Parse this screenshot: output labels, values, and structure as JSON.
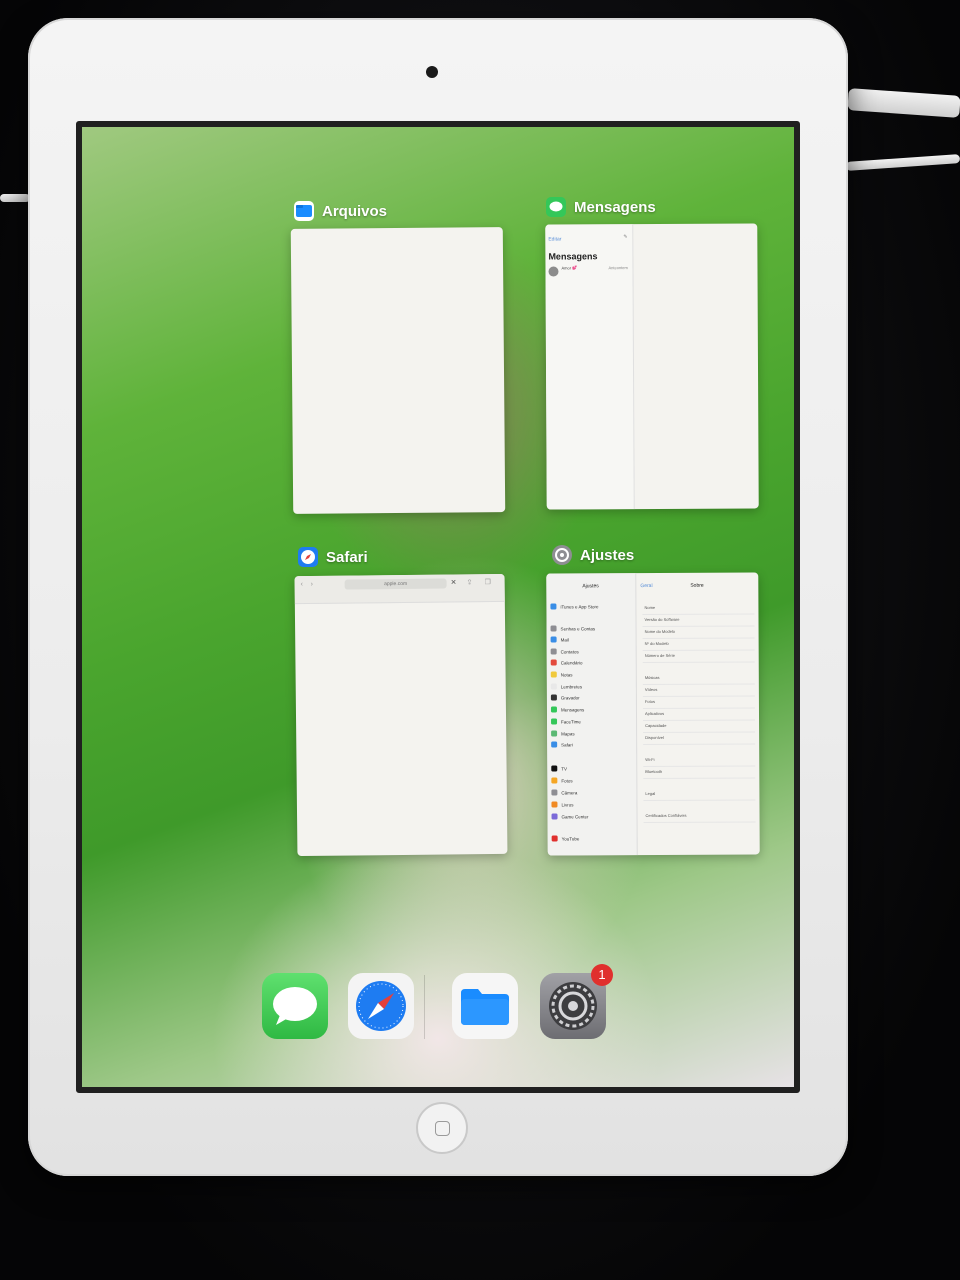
{
  "app_switcher": {
    "cards": [
      {
        "label": "Arquivos",
        "icon": "files-icon"
      },
      {
        "label": "Mensagens",
        "icon": "messages-icon",
        "preview": {
          "nav_back": "Editar",
          "title": "Mensagens",
          "contact": "Amor 💕",
          "date": "Anteontem"
        }
      },
      {
        "label": "Safari",
        "icon": "safari-icon",
        "preview": {
          "url": "apple.com"
        }
      },
      {
        "label": "Ajustes",
        "icon": "settings-icon",
        "preview": {
          "left_title": "Ajustes",
          "back": "Geral",
          "right_title": "Sobre",
          "left_items": [
            "iTunes e App Store",
            "Senhas e Contas",
            "Mail",
            "Contatos",
            "Calendário",
            "Notas",
            "Lembretes",
            "Gravador",
            "Mensagens",
            "FaceTime",
            "Mapas",
            "Safari",
            "TV",
            "Fotos",
            "Câmera",
            "Livros",
            "Game Center",
            "YouTube"
          ],
          "right_items": [
            "Nome",
            "Versão do Software",
            "Nome do Modelo",
            "Nº do Modelo",
            "Número de Série",
            "Músicas",
            "Vídeos",
            "Fotos",
            "Aplicativos",
            "Capacidade",
            "Disponível",
            "Wi-Fi",
            "Bluetooth",
            "Legal",
            "Certificados Confiáveis"
          ]
        }
      }
    ]
  },
  "dock": {
    "apps": [
      {
        "name": "Mensagens",
        "icon": "messages-icon",
        "color": "#34c759"
      },
      {
        "name": "Safari",
        "icon": "safari-icon",
        "color": "#1e7cf2"
      },
      {
        "name": "Arquivos",
        "icon": "files-icon",
        "color": "#1a8cff"
      },
      {
        "name": "Ajustes",
        "icon": "settings-icon",
        "color": "#8e8e93",
        "badge": "1"
      }
    ]
  }
}
